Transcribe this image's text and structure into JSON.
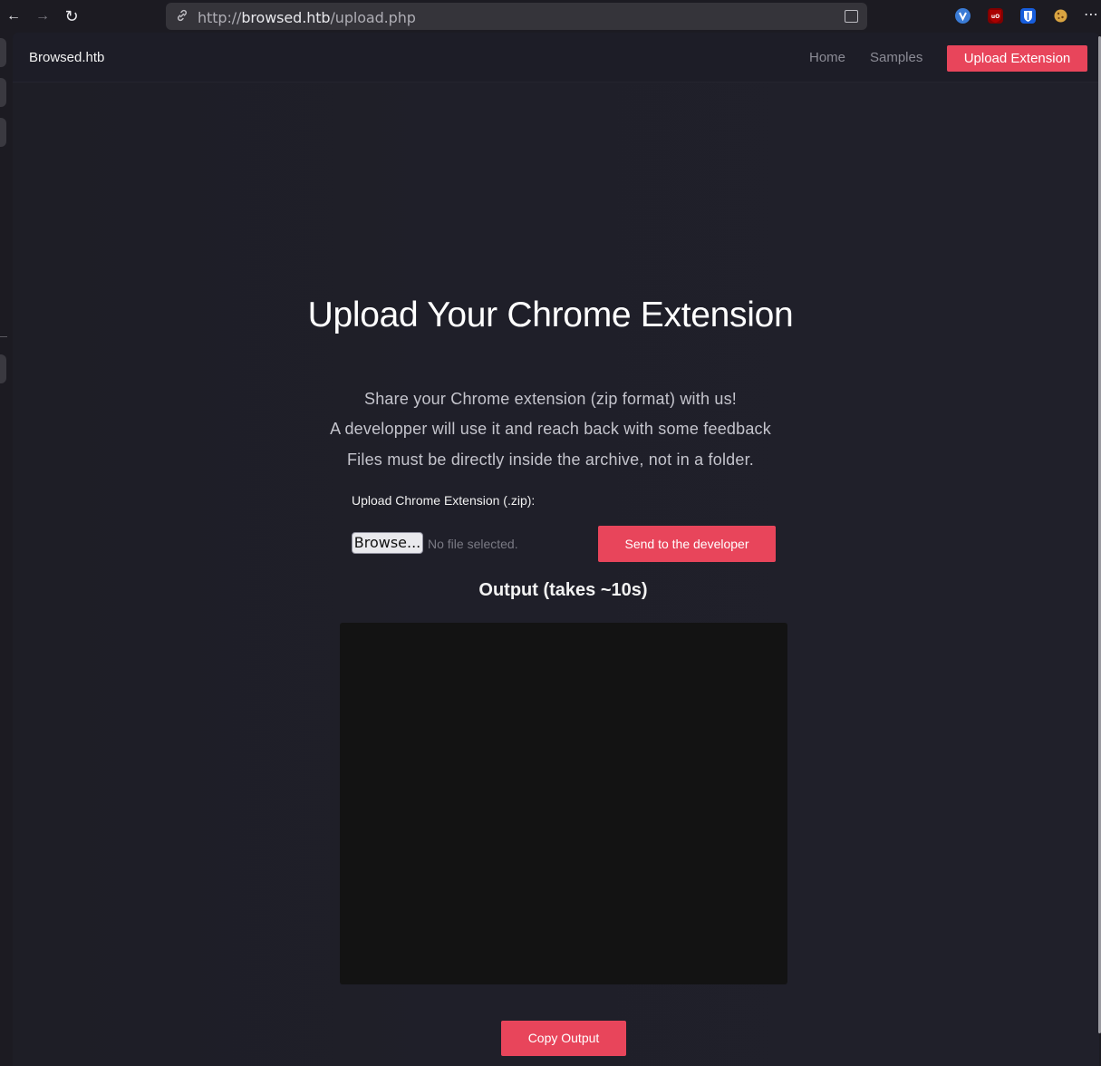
{
  "browser": {
    "url_prefix": "http://",
    "url_host": "browsed.htb",
    "url_path": "/upload.php",
    "icons": {
      "back": "←",
      "forward": "→",
      "reload": "↻",
      "more": "⋯"
    },
    "extensions": [
      "vivaldi-icon",
      "ublock-origin-icon",
      "bitwarden-icon",
      "cookie-icon"
    ]
  },
  "site_nav": {
    "brand": "Browsed.htb",
    "links": [
      "Home",
      "Samples"
    ],
    "cta": "Upload Extension"
  },
  "main": {
    "title": "Upload Your Chrome Extension",
    "intro_lines": [
      "Share your Chrome extension (zip format) with us!",
      "A developper will use it and reach back with some feedback",
      "Files must be directly inside the archive, not in a folder."
    ],
    "upload_label": "Upload Chrome Extension (.zip):",
    "browse_label": "Browse...",
    "file_status": "No file selected.",
    "send_label": "Send to the developer",
    "output_heading": "Output (takes ~10s)",
    "output_text": "",
    "copy_label": "Copy Output"
  },
  "colors": {
    "accent": "#e8455b",
    "background": "#1e1e26",
    "output_bg": "#131313"
  }
}
